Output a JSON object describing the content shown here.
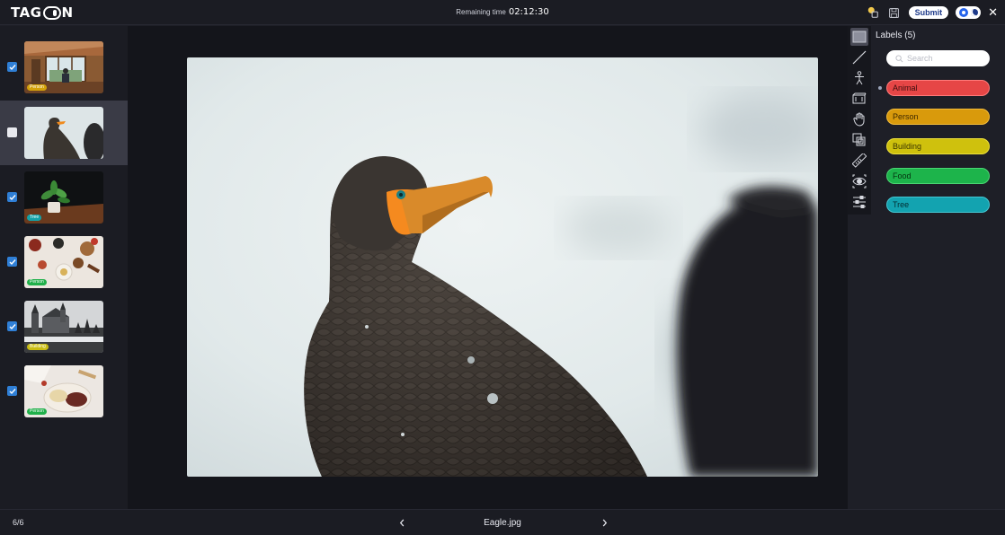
{
  "header": {
    "logo_text": "TAGON",
    "timer_label": "Remaining time",
    "timer_value": "02:12:30",
    "submit_label": "Submit",
    "close_label": "✕"
  },
  "sidebar": {
    "items": [
      {
        "checked": true,
        "tag": "Person",
        "tag_color": "#d4a20a",
        "scene": "cabin-person"
      },
      {
        "checked": false,
        "tag": "",
        "tag_color": "",
        "scene": "cormorant",
        "selected": true
      },
      {
        "checked": true,
        "tag": "Tree",
        "tag_color": "#14a3a8",
        "scene": "potted-plant"
      },
      {
        "checked": true,
        "tag": "Person",
        "tag_color": "#20b04a",
        "scene": "food-table"
      },
      {
        "checked": true,
        "tag": "Building",
        "tag_color": "#c9bd12",
        "scene": "castle-winter"
      },
      {
        "checked": true,
        "tag": "Person",
        "tag_color": "#20b04a",
        "scene": "food-bowl"
      }
    ]
  },
  "tools": [
    {
      "name": "rectangle-tool-icon",
      "active": true
    },
    {
      "name": "line-tool-icon"
    },
    {
      "name": "skeleton-tool-icon"
    },
    {
      "name": "cuboid-tool-icon"
    },
    {
      "name": "hand-pan-icon"
    },
    {
      "name": "copy-layers-icon"
    },
    {
      "name": "ruler-icon"
    },
    {
      "name": "eye-visibility-icon"
    },
    {
      "name": "sliders-settings-icon"
    }
  ],
  "labels_panel": {
    "title": "Labels (5)",
    "search_placeholder": "Search",
    "labels": [
      {
        "name": "Animal",
        "color": "#e64646",
        "border": "#ff7a7a",
        "active": true
      },
      {
        "name": "Person",
        "color": "#d99a0c",
        "border": "#f2bb3a"
      },
      {
        "name": "Building",
        "color": "#cfc10d",
        "border": "#ece03c"
      },
      {
        "name": "Food",
        "color": "#1db44b",
        "border": "#4ad673"
      },
      {
        "name": "Tree",
        "color": "#13a3b0",
        "border": "#45c7d3"
      }
    ]
  },
  "footer": {
    "counter": "6/6",
    "filename": "Eagle.jpg"
  },
  "colors": {
    "accent": "#2f7fd6",
    "background": "#1e1f27"
  }
}
